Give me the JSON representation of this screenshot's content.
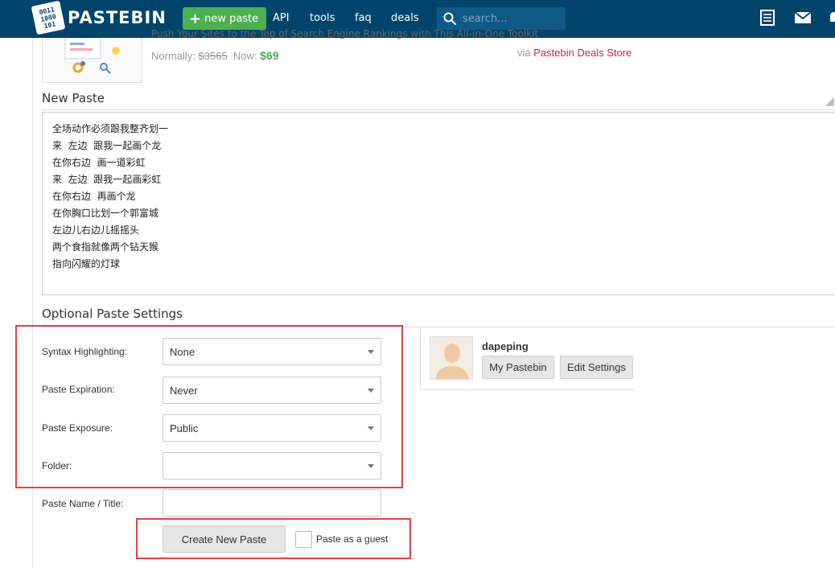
{
  "header": {
    "logo_text": "PASTEBIN",
    "logo_mark_lines": [
      "0011",
      "1000",
      "101"
    ],
    "new_paste_label": "new paste",
    "nav": [
      "API",
      "tools",
      "faq",
      "deals"
    ],
    "search_placeholder": "search...",
    "icons": [
      "document-list-icon",
      "mail-icon",
      "bell-icon"
    ]
  },
  "ad": {
    "headline": "Push Your Sites to the Top of Search Engine Rankings with This All-in-One Toolkit",
    "normally_label": "Normally:",
    "old_price": "$3565",
    "now_label": "Now:",
    "now_price": "$69",
    "via_label": "via",
    "store": "Pastebin Deals Store"
  },
  "new_paste": {
    "title": "New Paste",
    "content": "全场动作必须跟我整齐划一\n来  左边  跟我一起画个龙\n在你右边  画一道彩虹\n来  左边  跟我一起画彩虹\n在你右边  再画个龙\n在你胸口比划一个郭富城\n左边儿右边儿摇摇头\n两个食指就像两个钻天猴\n指向闪耀的灯球"
  },
  "settings": {
    "title": "Optional Paste Settings",
    "syntax_label": "Syntax Highlighting:",
    "syntax_value": "None",
    "expiration_label": "Paste Expiration:",
    "expiration_value": "Never",
    "exposure_label": "Paste Exposure:",
    "exposure_value": "Public",
    "folder_label": "Folder:",
    "folder_value": "",
    "name_label": "Paste Name / Title:",
    "name_value": "",
    "create_label": "Create New Paste",
    "guest_label": "Paste as a guest"
  },
  "user": {
    "username": "dapeping",
    "my_pastebin_label": "My Pastebin",
    "edit_settings_label": "Edit Settings"
  },
  "colors": {
    "header_bg": "#02456c",
    "accent_green": "#4caf50",
    "highlight_red": "#e2414b",
    "deal_link": "#d0204e"
  }
}
